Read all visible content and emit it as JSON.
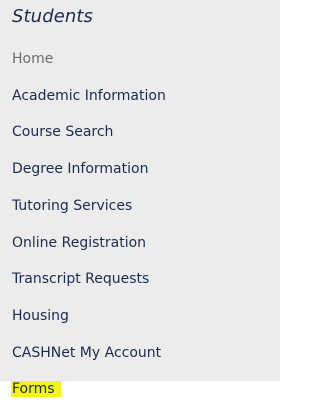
{
  "section": {
    "title": "Students"
  },
  "nav": {
    "items": [
      {
        "label": "Home"
      },
      {
        "label": "Academic Information"
      },
      {
        "label": "Course Search"
      },
      {
        "label": "Degree Information"
      },
      {
        "label": "Tutoring Services"
      },
      {
        "label": "Online Registration"
      },
      {
        "label": "Transcript Requests"
      },
      {
        "label": "Housing"
      },
      {
        "label": "CASHNet My Account"
      },
      {
        "label": "Forms"
      }
    ]
  },
  "colors": {
    "panel_background": "#ececec",
    "link_text": "#1b2b4f",
    "current_item_text": "#6b6b6b",
    "highlight": "#f3f519"
  }
}
